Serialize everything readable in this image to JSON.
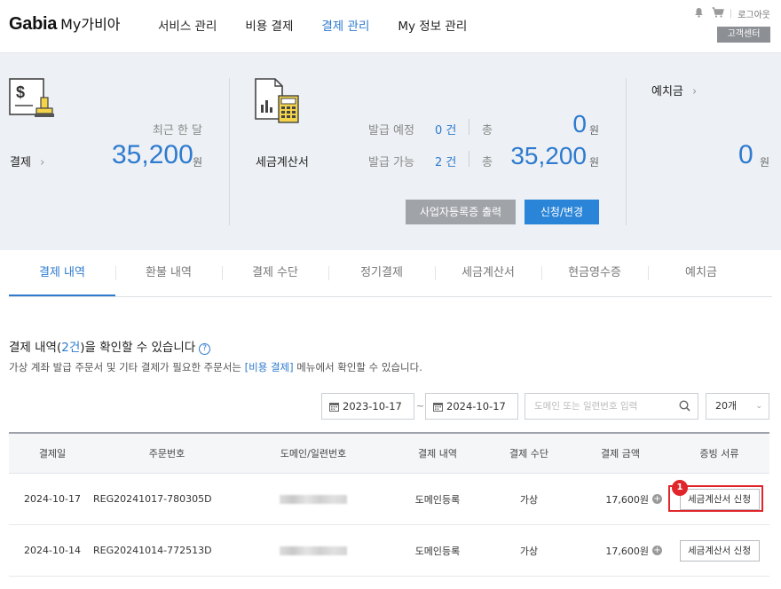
{
  "header": {
    "logo_brand": "Gabia",
    "logo_sub": "My가비아",
    "nav": [
      "서비스 관리",
      "비용 결제",
      "결제 관리",
      "My 정보 관리"
    ],
    "active_nav_index": 2,
    "logout_label": "로그아웃",
    "customer_center_label": "고객센터",
    "icons": [
      "bell-icon",
      "cart-icon"
    ]
  },
  "summary": {
    "payment": {
      "link_label": "결제",
      "period_label": "최근 한 달",
      "amount": "35,200",
      "unit": "원"
    },
    "tax_invoice": {
      "title": "세금계산서",
      "scheduled_label": "발급 예정",
      "scheduled_count": "0 건",
      "available_label": "발급 가능",
      "available_count": "2 건",
      "total_label": "총",
      "scheduled_amount": "0",
      "available_amount": "35,200",
      "unit": "원",
      "print_button": "사업자등록증 출력",
      "apply_button": "신청/변경"
    },
    "deposit": {
      "link_label": "예치금",
      "amount": "0",
      "unit": "원"
    }
  },
  "tabs": [
    "결제 내역",
    "환불 내역",
    "결제 수단",
    "정기결제",
    "세금계산서",
    "현금영수증",
    "예치금"
  ],
  "active_tab_index": 0,
  "info": {
    "title_prefix": "결제 내역(",
    "title_count": "2건",
    "title_suffix": ")을 확인할 수 있습니다",
    "help_glyph": "?",
    "desc_prefix": "가상 계좌 발급 주문서 및 기타 결제가 필요한 주문서는 ",
    "desc_link": "[비용 결제]",
    "desc_suffix": " 메뉴에서 확인할 수 있습니다."
  },
  "filters": {
    "start_date": "2023-10-17",
    "end_date": "2024-10-17",
    "separator": "~",
    "search_placeholder": "도메인 또는 일련번호 입력",
    "page_size": "20개"
  },
  "table": {
    "columns": [
      "결제일",
      "주문번호",
      "도메인/일련번호",
      "결제 내역",
      "결제 수단",
      "결제 금액",
      "증빙 서류"
    ],
    "rows": [
      {
        "date": "2024-10-17",
        "order_no": "REG20241017-780305D",
        "item": "도메인등록",
        "method": "가상",
        "amount": "17,600원",
        "doc_button": "세금계산서 신청"
      },
      {
        "date": "2024-10-14",
        "order_no": "REG20241014-772513D",
        "item": "도메인등록",
        "method": "가상",
        "amount": "17,600원",
        "doc_button": "세금계산서 신청"
      }
    ]
  },
  "annotation": {
    "badge": "1"
  },
  "colors": {
    "accent": "#2e7bcf",
    "panel_bg": "#edf0f4",
    "highlight": "#e0262b"
  }
}
